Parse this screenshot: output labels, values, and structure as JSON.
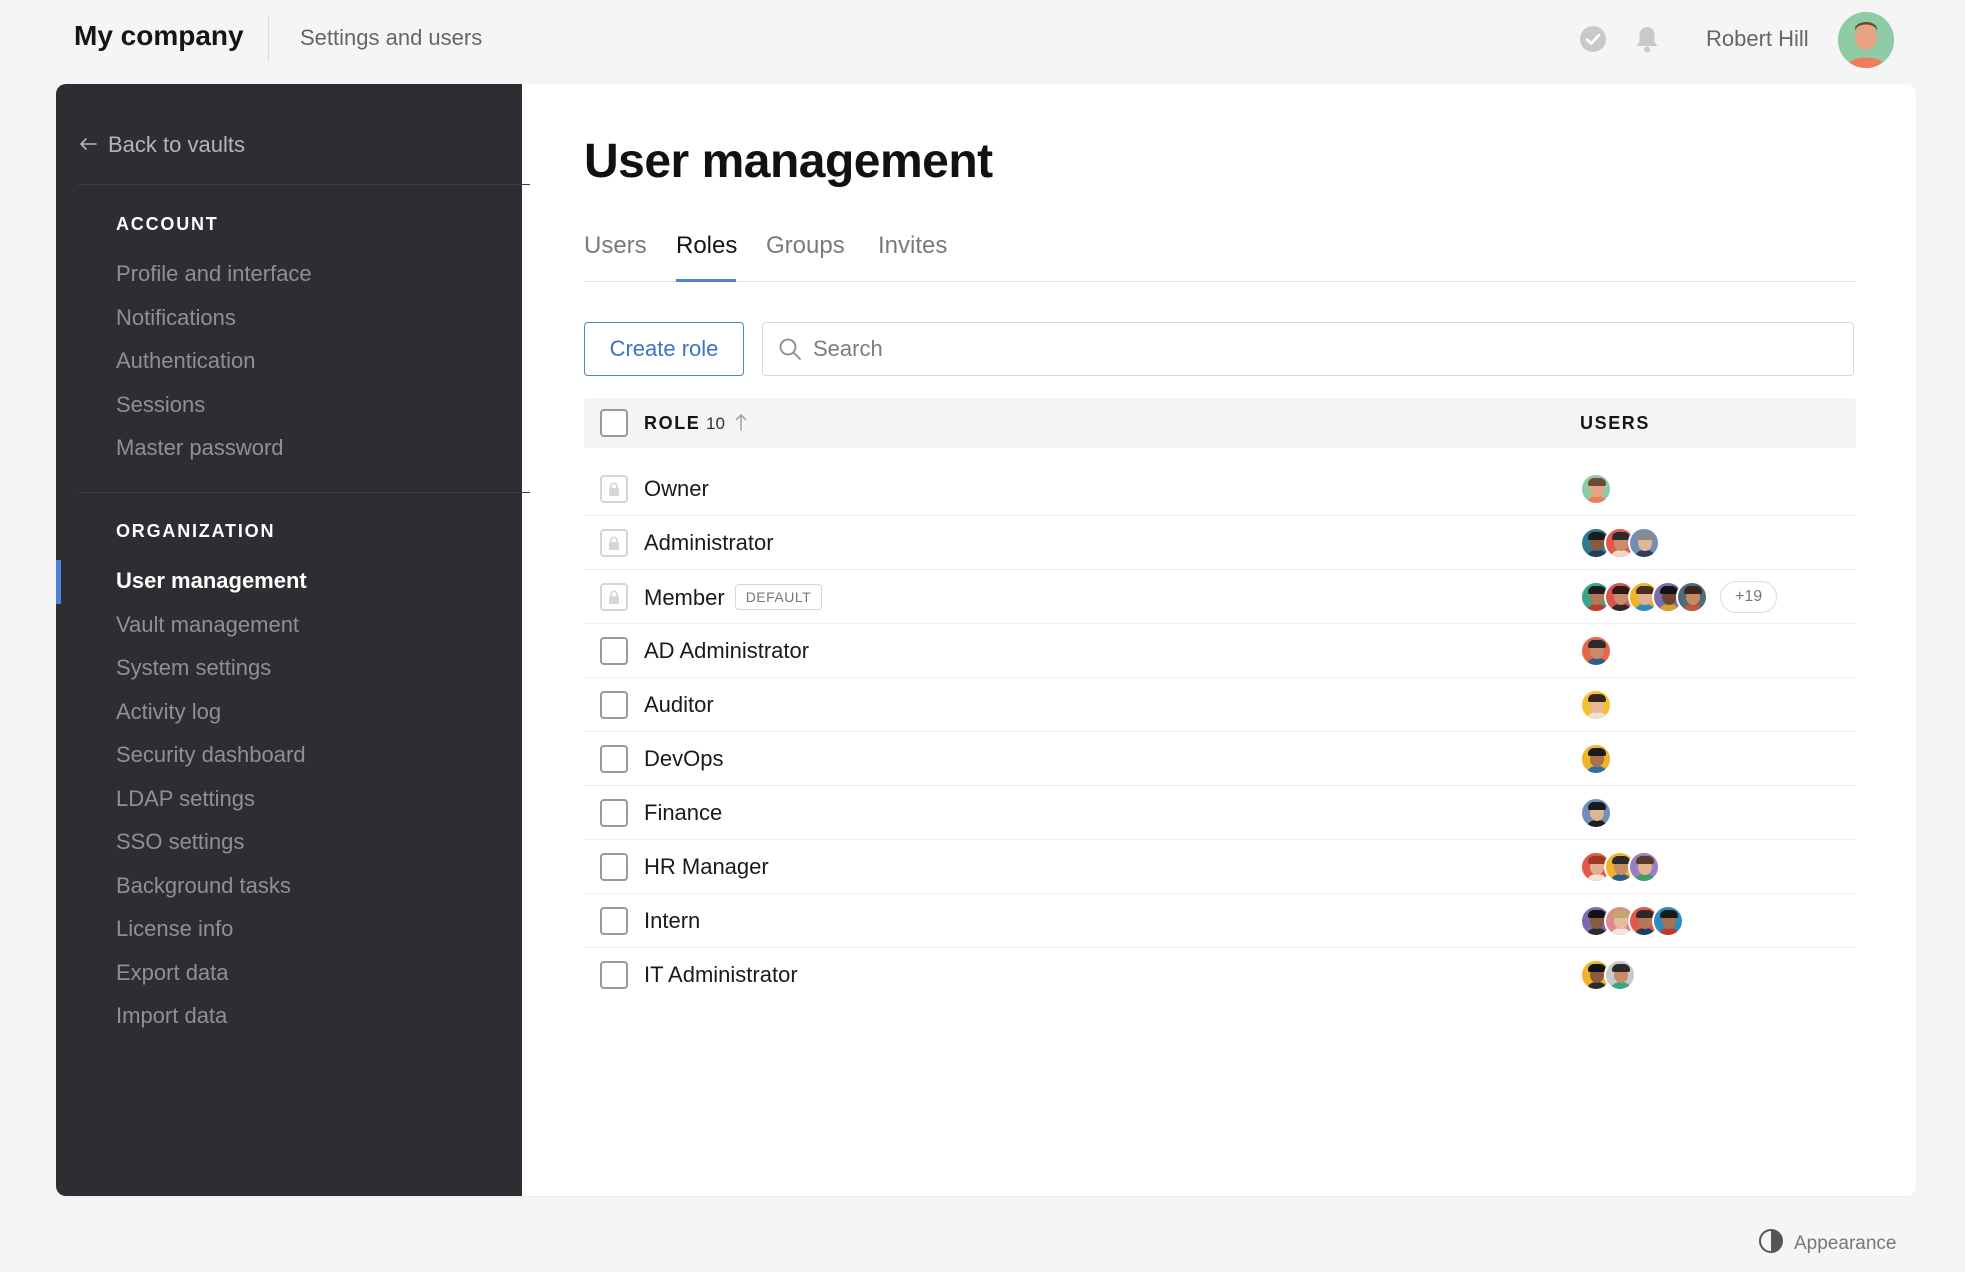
{
  "header": {
    "brand": "My company",
    "breadcrumb": "Settings and users",
    "username": "Robert Hill",
    "icons": [
      "check-circle-icon",
      "bell-icon"
    ]
  },
  "sidebar": {
    "back_label": "Back to vaults",
    "account_title": "ACCOUNT",
    "account_items": [
      "Profile and interface",
      "Notifications",
      "Authentication",
      "Sessions",
      "Master password"
    ],
    "org_title": "ORGANIZATION",
    "org_items": [
      "User management",
      "Vault management",
      "System settings",
      "Activity log",
      "Security dashboard",
      "LDAP settings",
      "SSO settings",
      "Background tasks",
      "License info",
      "Export data",
      "Import data"
    ],
    "active_item": "User management"
  },
  "main": {
    "title": "User management",
    "tabs": [
      "Users",
      "Roles",
      "Groups",
      "Invites"
    ],
    "active_tab": "Roles",
    "create_label": "Create role",
    "search_placeholder": "Search",
    "table": {
      "role_header": "ROLE",
      "role_count": "10",
      "users_header": "USERS",
      "rows": [
        {
          "name": "Owner",
          "locked": true,
          "badge": "",
          "avatars": 1,
          "more": ""
        },
        {
          "name": "Administrator",
          "locked": true,
          "badge": "",
          "avatars": 3,
          "more": ""
        },
        {
          "name": "Member",
          "locked": true,
          "badge": "DEFAULT",
          "avatars": 5,
          "more": "+19"
        },
        {
          "name": "AD Administrator",
          "locked": false,
          "badge": "",
          "avatars": 1,
          "more": ""
        },
        {
          "name": "Auditor",
          "locked": false,
          "badge": "",
          "avatars": 1,
          "more": ""
        },
        {
          "name": "DevOps",
          "locked": false,
          "badge": "",
          "avatars": 1,
          "more": ""
        },
        {
          "name": "Finance",
          "locked": false,
          "badge": "",
          "avatars": 1,
          "more": ""
        },
        {
          "name": "HR Manager",
          "locked": false,
          "badge": "",
          "avatars": 3,
          "more": ""
        },
        {
          "name": "Intern",
          "locked": false,
          "badge": "",
          "avatars": 4,
          "more": ""
        },
        {
          "name": "IT Administrator",
          "locked": false,
          "badge": "",
          "avatars": 2,
          "more": ""
        }
      ]
    }
  },
  "footer": {
    "appearance_label": "Appearance"
  },
  "colors": {
    "accent": "#4e82d6",
    "sidebar_bg": "#2d2e31",
    "page_bg": "#f5f5f6"
  }
}
